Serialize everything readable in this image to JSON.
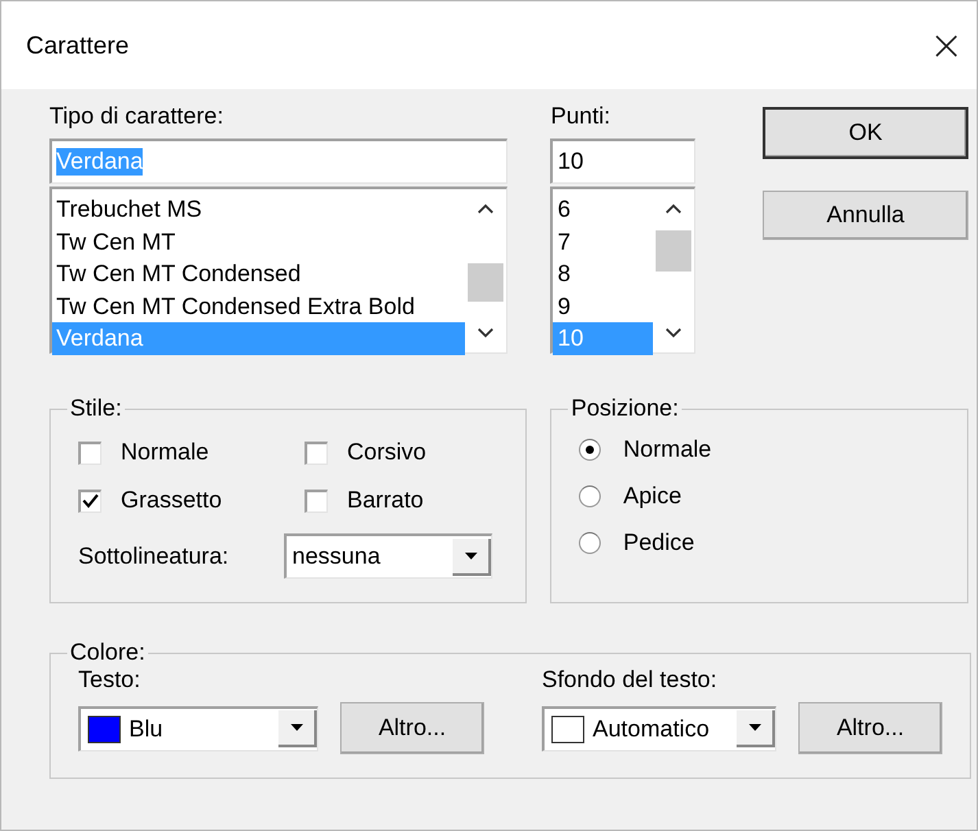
{
  "window": {
    "title": "Carattere",
    "close": "×"
  },
  "font": {
    "label": "Tipo di carattere:",
    "value": "Verdana",
    "items": [
      {
        "label": "Trebuchet MS",
        "selected": false
      },
      {
        "label": "Tw Cen MT",
        "selected": false
      },
      {
        "label": "Tw Cen MT Condensed",
        "selected": false
      },
      {
        "label": "Tw Cen MT Condensed Extra Bold",
        "selected": false
      },
      {
        "label": "Verdana",
        "selected": true
      }
    ]
  },
  "size": {
    "label": "Punti:",
    "value": "10",
    "items": [
      {
        "label": "6",
        "selected": false
      },
      {
        "label": "7",
        "selected": false
      },
      {
        "label": "8",
        "selected": false
      },
      {
        "label": "9",
        "selected": false
      },
      {
        "label": "10",
        "selected": true
      }
    ]
  },
  "buttons": [
    {
      "label": "OK",
      "default": true
    },
    {
      "label": "Annulla",
      "default": false
    }
  ],
  "style": {
    "title": "Stile:",
    "checkboxes": [
      {
        "label": "Normale",
        "checked": false
      },
      {
        "label": "Corsivo",
        "checked": false
      },
      {
        "label": "Grassetto",
        "checked": true
      },
      {
        "label": "Barrato",
        "checked": false
      }
    ],
    "underline": {
      "label": "Sottolineatura:",
      "value": "nessuna"
    }
  },
  "position": {
    "title": "Posizione:",
    "radios": [
      {
        "label": "Normale",
        "selected": true
      },
      {
        "label": "Apice",
        "selected": false
      },
      {
        "label": "Pedice",
        "selected": false
      }
    ]
  },
  "color": {
    "title": "Colore:",
    "pickers": [
      {
        "label": "Testo:",
        "value": "Blu",
        "color": "#0000ff",
        "button": "Altro..."
      },
      {
        "label": "Sfondo del testo:",
        "value": "Automatico",
        "color": "#ffffff",
        "button": "Altro..."
      }
    ]
  }
}
